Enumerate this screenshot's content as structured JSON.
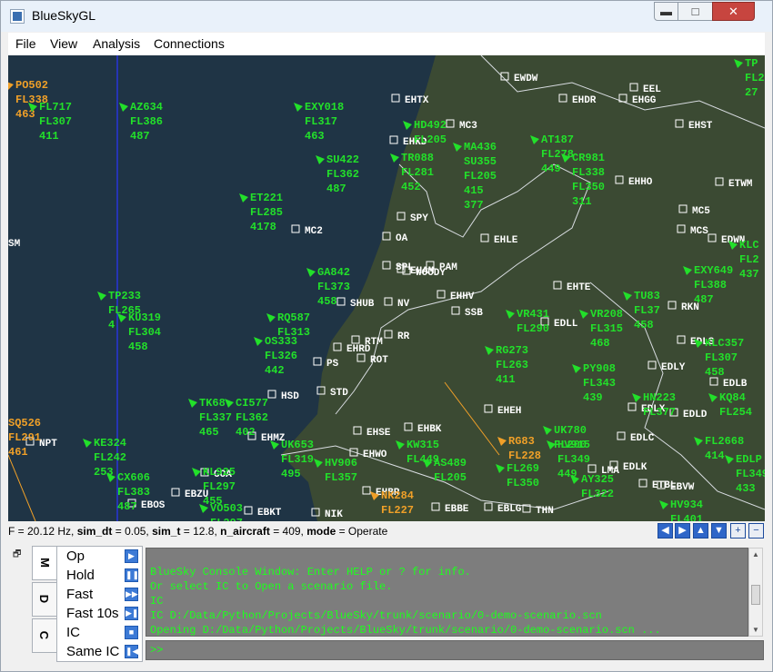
{
  "window": {
    "title": "BlueSkyGL",
    "controls": {
      "minimize": "▬",
      "maximize": "□",
      "close": "✕"
    }
  },
  "menubar": {
    "items": [
      "File",
      "View",
      "Analysis",
      "Connections"
    ]
  },
  "radar": {
    "colors": {
      "aircraft": "#22e02a",
      "selected_aircraft": "#f0a028",
      "waypoint": "#ffffff",
      "coast": "#d9dde2",
      "meridian": "#2a35ff"
    },
    "aircraft": [
      {
        "lines": [
          "PO502",
          "FL338",
          "463"
        ],
        "color": "#f0a028"
      },
      {
        "lines": [
          "FL717",
          "FL307",
          "411"
        ]
      },
      {
        "lines": [
          "AZ634",
          "FL386",
          "487"
        ]
      },
      {
        "lines": [
          "EXY018",
          "FL317",
          "463"
        ]
      },
      {
        "lines": [
          "HD492",
          "FL205"
        ]
      },
      {
        "lines": [
          "MA436",
          "SU355",
          "FL205",
          "415",
          "377"
        ]
      },
      {
        "lines": [
          "AT187",
          "FL278",
          "449"
        ]
      },
      {
        "lines": [
          "CR981",
          "FL338",
          "FL350",
          "311"
        ]
      },
      {
        "lines": [
          "TR088",
          "FL281",
          "452"
        ]
      },
      {
        "lines": [
          "SU422",
          "FL362",
          "487"
        ]
      },
      {
        "lines": [
          "ET221",
          "FL285",
          "4178"
        ]
      },
      {
        "lines": [
          "GA842",
          "FL373",
          "458"
        ]
      },
      {
        "lines": [
          "TP233",
          "FL265",
          "4"
        ]
      },
      {
        "lines": [
          "KU319",
          "FL304",
          "458"
        ]
      },
      {
        "lines": [
          "RQ587",
          "FL313"
        ]
      },
      {
        "lines": [
          "OS333",
          "FL326",
          "442"
        ]
      },
      {
        "lines": [
          "VR431",
          "FL290"
        ]
      },
      {
        "lines": [
          "VR208",
          "FL315",
          "468"
        ]
      },
      {
        "lines": [
          "TU83",
          "FL37",
          "458"
        ]
      },
      {
        "lines": [
          "EXY649",
          "FL388",
          "487"
        ]
      },
      {
        "lines": [
          "RG273",
          "FL263",
          "411"
        ]
      },
      {
        "lines": [
          "PY908",
          "FL343",
          "439"
        ]
      },
      {
        "lines": [
          "KLC357",
          "FL307",
          "458"
        ]
      },
      {
        "lines": [
          "TK68",
          "FL337",
          "465"
        ]
      },
      {
        "lines": [
          "CI577",
          "FL362",
          "402"
        ]
      },
      {
        "lines": [
          "HN223",
          "FL377"
        ]
      },
      {
        "lines": [
          "KQ84",
          "FL254"
        ]
      },
      {
        "lines": [
          "SQ526",
          "FL291",
          "461"
        ],
        "color": "#f0a028"
      },
      {
        "lines": [
          "KE324",
          "FL242",
          "253"
        ]
      },
      {
        "lines": [
          "UK653",
          "FL319",
          "495"
        ]
      },
      {
        "lines": [
          "HV906",
          "FL357"
        ]
      },
      {
        "lines": [
          "RG83",
          "FL228"
        ],
        "color": "#f0a028"
      },
      {
        "lines": [
          "HV915",
          "FL349",
          "449"
        ]
      },
      {
        "lines": [
          "KW315",
          "FL449"
        ]
      },
      {
        "lines": [
          "AS489",
          "FL205"
        ]
      },
      {
        "lines": [
          "FL269",
          "FL350"
        ]
      },
      {
        "lines": [
          "FL2668",
          "414"
        ]
      },
      {
        "lines": [
          "KL925",
          "FL297",
          "455"
        ]
      },
      {
        "lines": [
          "CX606",
          "FL383",
          "487"
        ]
      },
      {
        "lines": [
          "VO503",
          "FL297"
        ]
      },
      {
        "lines": [
          "NK284",
          "FL227"
        ],
        "color": "#f0a028"
      },
      {
        "lines": [
          "AY325",
          "FL322"
        ]
      },
      {
        "lines": [
          "UK780",
          "FL200"
        ]
      },
      {
        "lines": [
          "HV934",
          "FL401"
        ]
      },
      {
        "lines": [
          "EDLP",
          "FL3492",
          "433"
        ]
      },
      {
        "lines": [
          "TP",
          "FL2",
          "27"
        ]
      },
      {
        "lines": [
          "KLC",
          "FL2",
          "437"
        ]
      }
    ],
    "waypoints": [
      "EWDW",
      "EHTX",
      "EHDR",
      "EEL",
      "EHGG",
      "EHST",
      "EHKD",
      "MC3",
      "EHHO",
      "ETWM",
      "MC5",
      "MC2",
      "SPY",
      "OA",
      "EHLE",
      "MCS",
      "EDWN",
      "SPL",
      "EHAM",
      "PAM",
      "WOODY",
      "SHUB",
      "NV",
      "EHHV",
      "SSB",
      "EHTE",
      "EDLL",
      "RKN",
      "RR",
      "RTM",
      "EHRD",
      "ROT",
      "EDLS",
      "PS",
      "EDLY",
      "STD",
      "EDLB",
      "HSD",
      "EHEH",
      "EDLX",
      "EDLD",
      "EDLC",
      "EHSE",
      "EHBK",
      "EHMZ",
      "EHWO",
      "EHBR",
      "NPT",
      "COA",
      "EBZU",
      "EBOS",
      "EBKT",
      "EBBE",
      "EBLG",
      "NIK",
      "THN",
      "LMA",
      "EDLK",
      "EBVW",
      "ETBL",
      "SM"
    ],
    "left_labels": [
      "SM"
    ]
  },
  "statusbar": {
    "parts": [
      {
        "text": "F = 20.12 Hz, "
      },
      {
        "text": "sim_dt",
        "bold": true
      },
      {
        "text": " = 0.05, "
      },
      {
        "text": "sim_t",
        "bold": true
      },
      {
        "text": " = 12.8, "
      },
      {
        "text": "n_aircraft",
        "bold": true
      },
      {
        "text": " = 409, "
      },
      {
        "text": "mode",
        "bold": true
      },
      {
        "text": " = Operate"
      }
    ]
  },
  "nav": {
    "icons": [
      "pan-left-icon",
      "pan-right-icon",
      "pan-up-icon",
      "pan-down-icon",
      "zoom-in-icon",
      "zoom-out-icon"
    ],
    "glyphs": [
      "◀",
      "▶",
      "▲",
      "▼",
      "+",
      "−"
    ]
  },
  "side_tabs": [
    "M",
    "D",
    "C"
  ],
  "sim_controls": [
    {
      "label": "Op",
      "glyph": "▶"
    },
    {
      "label": "Hold",
      "glyph": "❚❚"
    },
    {
      "label": "Fast",
      "glyph": "▶▶"
    },
    {
      "label": "Fast 10s",
      "glyph": "▶❚"
    },
    {
      "label": "IC",
      "glyph": "■"
    },
    {
      "label": "Same IC",
      "glyph": "❚◀"
    }
  ],
  "console": {
    "lines": [
      "BlueSky Console Window: Enter HELP or ? for info.",
      "Or select IC to Open a scenario file.",
      "IC",
      "IC D:/Data/Python/Projects/BlueSky/trunk/scenario/0-demo-scenario.scn",
      "Opening D:/Data/Python/Projects/BlueSky/trunk/scenario/0-demo-scenario.scn ..."
    ]
  },
  "command": {
    "prompt": ">>",
    "value": ""
  }
}
